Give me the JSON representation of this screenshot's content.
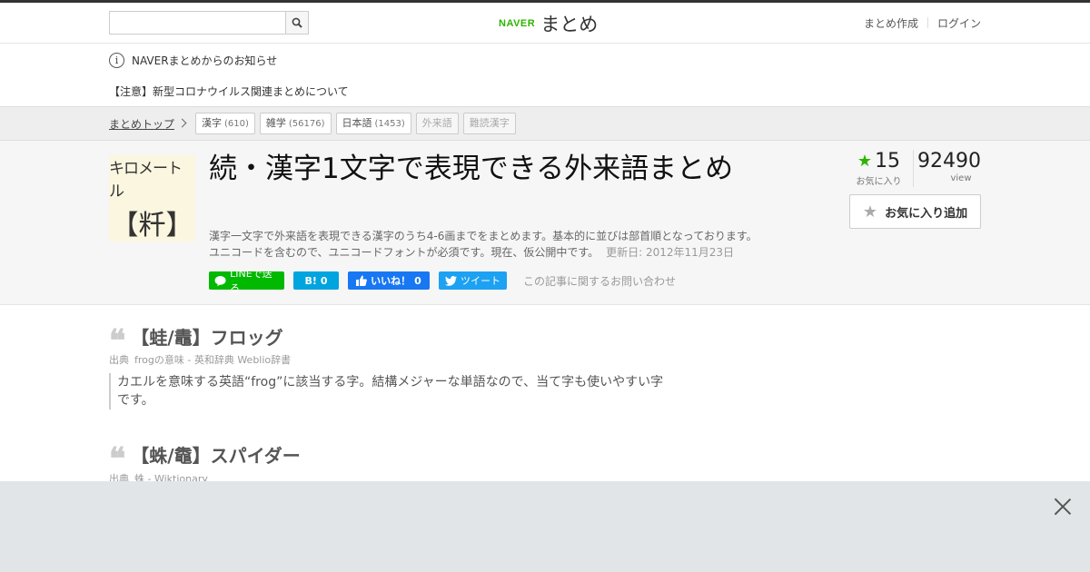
{
  "header": {
    "search_placeholder": "",
    "logo_brand": "NAVER",
    "logo_name": "まとめ",
    "links": [
      "まとめ作成",
      "ログイン"
    ]
  },
  "notice": {
    "title": "NAVERまとめからのお知らせ",
    "item": "【注意】新型コロナウイルス関連まとめについて"
  },
  "breadcrumb": {
    "top": "まとめトップ",
    "tags": [
      {
        "label": "漢字",
        "count": "(610)"
      },
      {
        "label": "雑学",
        "count": "(56176)"
      },
      {
        "label": "日本語",
        "count": "(1453)"
      },
      {
        "label": "外来語",
        "count": ""
      },
      {
        "label": "難読漢字",
        "count": ""
      }
    ]
  },
  "article": {
    "thumb_line1": "キロメートル",
    "thumb_line2": "【粁】",
    "title": "続・漢字1文字で表現できる外来語まとめ",
    "description_line1": "漢字一文字で外来語を表現できる漢字のうち4-6画までをまとめます。基本的に並びは部首順となっております。",
    "description_line2": "ユニコードを含むので、ユニコードフォントが必須です。現在、仮公開中です。",
    "updated": "更新日: 2012年11月23日",
    "fav_count": "15",
    "fav_label": "お気に入り",
    "view_count": "92490",
    "view_label": "view",
    "fav_button": "お気に入り追加"
  },
  "social": {
    "line": "LINEで送る",
    "hatena_count": "0",
    "fb_label": "いいね！",
    "fb_count": "0",
    "tweet": "ツイート",
    "contact": "この記事に関するお問い合わせ"
  },
  "entries": [
    {
      "heading": "【蛙/鼃】フロッグ",
      "source_label": "出典",
      "source_link": "frogの意味 - 英和辞典 Weblio辞書",
      "quote": "カエルを意味する英語“frog”に該当する字。結構メジャーな単語なので、当て字も使いやすい字です。"
    },
    {
      "heading": "【蛛/鼄】スパイダー",
      "source_label": "出典",
      "source_link": "蛛 - Wiktionary"
    }
  ],
  "colors": {
    "brand_green": "#2db400",
    "line_green": "#00b900",
    "hatena_blue": "#00a4de",
    "facebook_blue": "#1877f2",
    "twitter_blue": "#1da1f2",
    "overlay_gray": "#e2e5e8"
  },
  "icons": [
    "search-icon",
    "info-icon",
    "chevron-right-icon",
    "star-icon",
    "line-icon",
    "hatena-icon",
    "facebook-like-icon",
    "twitter-icon",
    "quote-icon",
    "close-icon"
  ]
}
